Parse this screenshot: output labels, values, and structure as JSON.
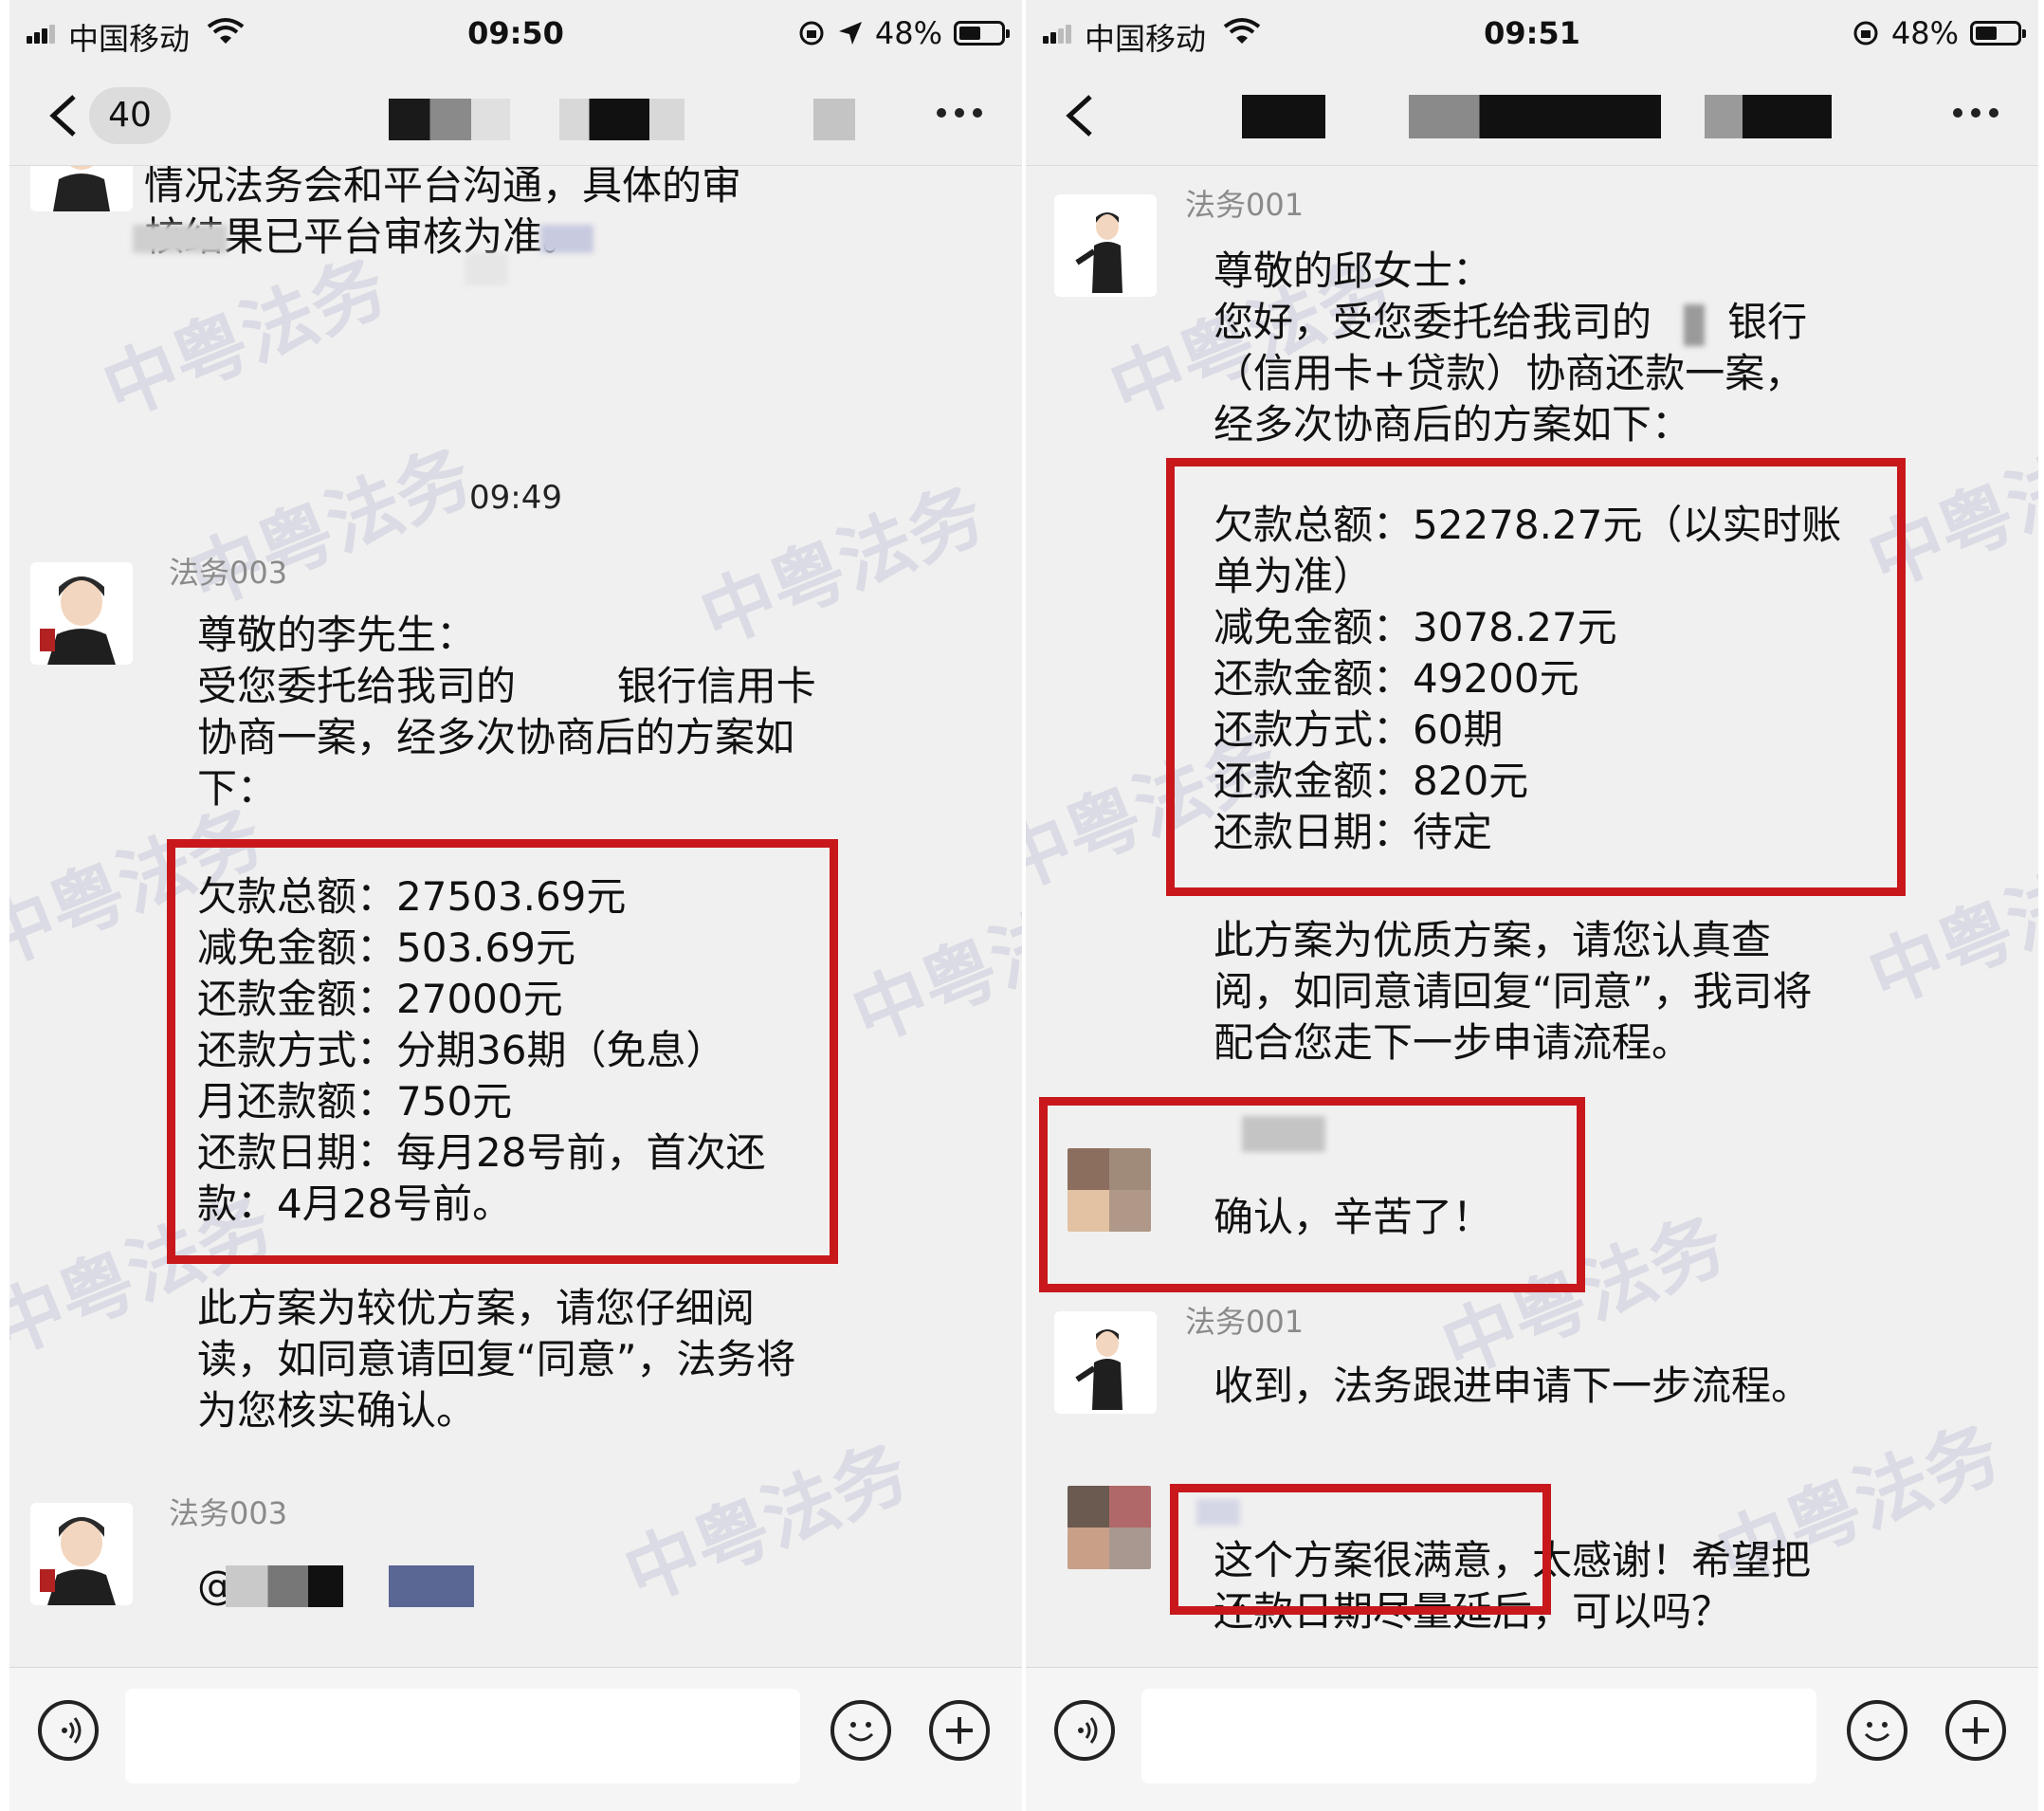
{
  "left": {
    "status": {
      "carrier": "中国移动",
      "time": "09:50",
      "battery": "48%"
    },
    "nav": {
      "unread": "40"
    },
    "messages": {
      "top_cont": "情况法务会和平台沟通，具体的审\n核结果已平台审核为准。",
      "time_divider": "09:49",
      "sender1": "法务003",
      "greeting": "尊敬的李先生：\n受您委托给我司的        银行信用卡\n协商一案，经多次协商后的方案如\n下：",
      "plan": "欠款总额：27503.69元\n减免金额：503.69元\n还款金额：27000元\n还款方式：分期36期（免息）\n月还款额：750元\n还款日期：每月28号前，首次还\n款：4月28号前。",
      "note": "此方案为较优方案，请您仔细阅\n读，如同意请回复“同意”，法务将\n为您核实确认。",
      "sender2": "法务003",
      "mention": "@"
    }
  },
  "right": {
    "status": {
      "carrier": "中国移动",
      "time": "09:51",
      "battery": "48%"
    },
    "messages": {
      "sender1": "法务001",
      "greeting": "尊敬的邱女士：\n您好，受您委托给我司的      银行\n（信用卡+贷款）协商还款一案，\n经多次协商后的方案如下：",
      "plan": "欠款总额：52278.27元（以实时账\n单为准）\n减免金额：3078.27元\n还款金额：49200元\n还款方式：60期\n还款金额：820元\n还款日期：待定",
      "note": "此方案为优质方案，请您认真查\n阅，如同意请回复“同意”，我司将\n配合您走下一步申请流程。",
      "client_reply1": "确认，辛苦了！",
      "sender2": "法务001",
      "lawyer_reply": "收到，法务跟进申请下一步流程。",
      "client_reply2": "这个方案很满意，太感谢！希望把\n还款日期尽量延后，可以吗？"
    }
  },
  "watermark": "中粤法务",
  "colors": {
    "highlight": "#c8181c",
    "background": "#f0f0f0",
    "sender": "#8a8a8a"
  }
}
